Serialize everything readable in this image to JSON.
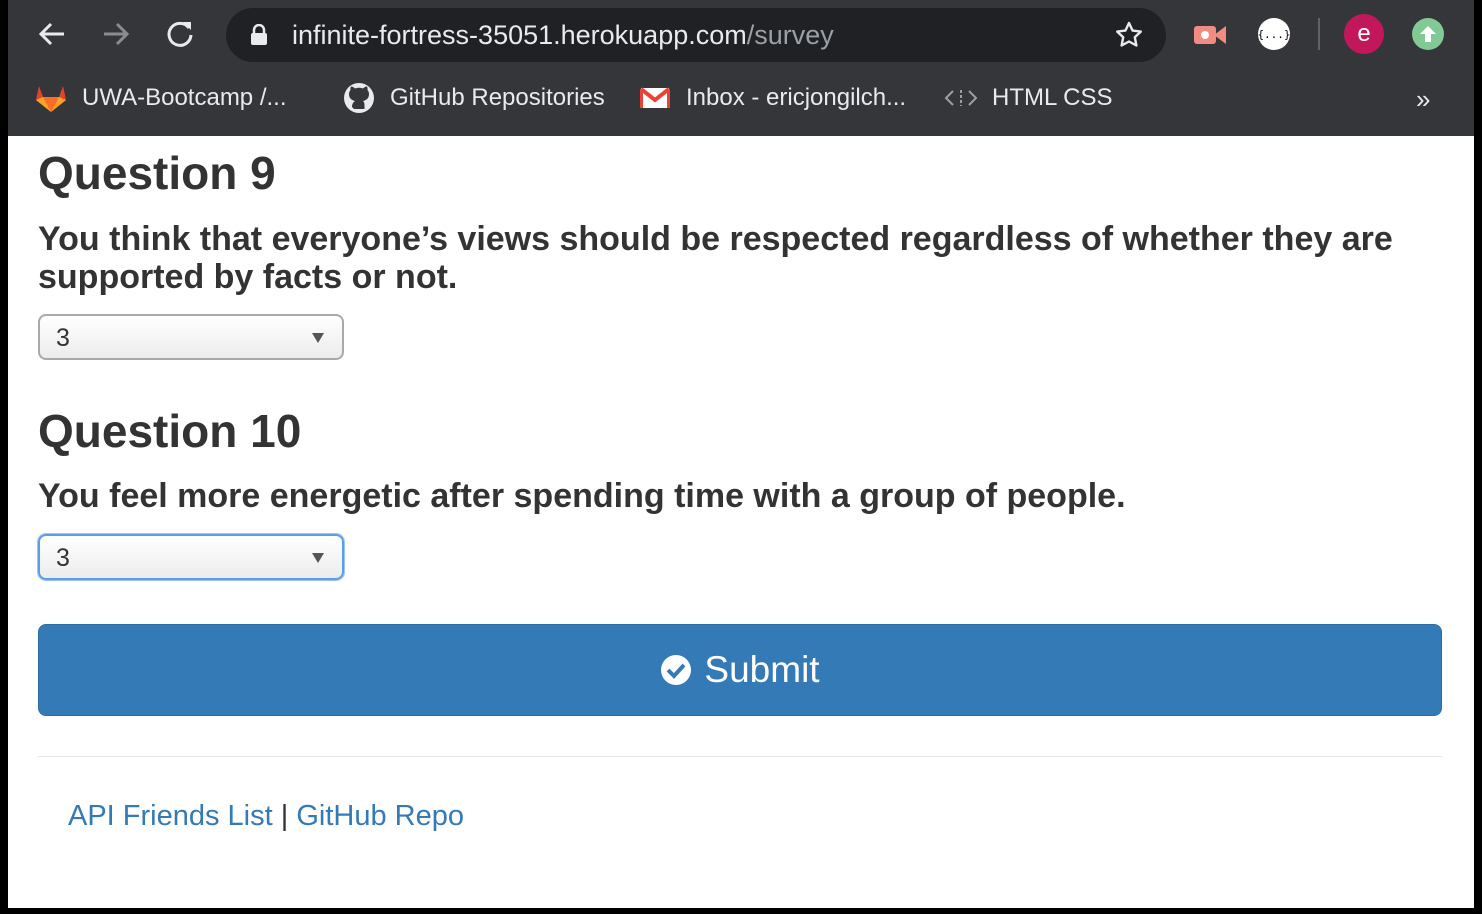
{
  "browser": {
    "url_host": "infinite-fortress-35051.herokuapp.com",
    "url_path": "/survey",
    "profile_initial": "e",
    "bookmarks": [
      {
        "label": "UWA-Bootcamp /...",
        "icon": "gitlab-icon"
      },
      {
        "label": "GitHub Repositories",
        "icon": "github-icon"
      },
      {
        "label": "Inbox - ericjongilch...",
        "icon": "gmail-icon"
      },
      {
        "label": "HTML CSS",
        "icon": "code-icon"
      }
    ],
    "overflow": "»",
    "extension_json_label": "{...}"
  },
  "questions": [
    {
      "title": "Question 9",
      "text": "You think that everyone’s views should be respected regardless of whether they are supported by facts or not.",
      "value": "3"
    },
    {
      "title": "Question 10",
      "text": "You feel more energetic after spending time with a group of people.",
      "value": "3"
    }
  ],
  "submit_label": "Submit",
  "footer": {
    "link1": "API Friends List",
    "separator": "|",
    "link2": "GitHub Repo"
  },
  "colors": {
    "primary": "#337ab7",
    "chrome": "#35363a",
    "omnibox": "#202124",
    "profile": "#c2185b"
  }
}
